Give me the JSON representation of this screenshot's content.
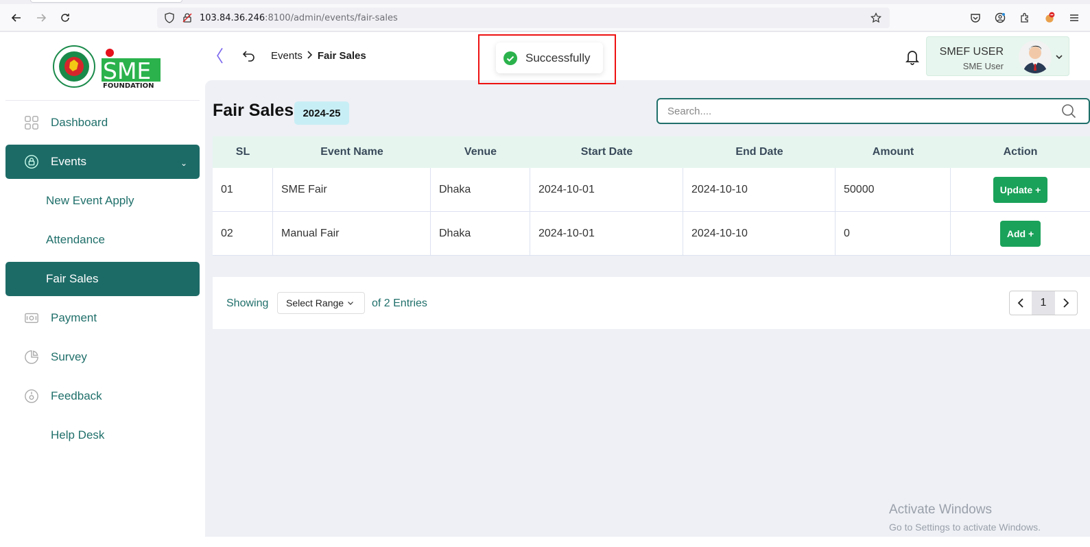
{
  "browser": {
    "url_host": "103.84.36.246",
    "url_rest": ":8100/admin/events/fair-sales"
  },
  "logo": {
    "brand": "SME",
    "sub": "FOUNDATION"
  },
  "sidebar": {
    "items": [
      {
        "label": "Dashboard",
        "icon": "grid-icon",
        "active": false
      },
      {
        "label": "Events",
        "icon": "lock-circle-icon",
        "active": true
      },
      {
        "label": "New Event Apply",
        "sub": true
      },
      {
        "label": "Attendance",
        "sub": true
      },
      {
        "label": "Fair Sales",
        "sub": true,
        "active": true
      },
      {
        "label": "Payment",
        "icon": "cash-icon"
      },
      {
        "label": "Survey",
        "icon": "pie-icon"
      },
      {
        "label": "Feedback",
        "icon": "feedback-icon"
      },
      {
        "label": "Help Desk",
        "icon": ""
      }
    ]
  },
  "header": {
    "breadcrumb_parent": "Events",
    "breadcrumb_current": "Fair Sales",
    "toast_message": "Successfully",
    "user_name": "SMEF USER",
    "user_role": "SME User"
  },
  "page": {
    "title": "Fair Sales",
    "year": "2024-25",
    "search_placeholder": "Search...."
  },
  "table": {
    "columns": [
      "SL",
      "Event Name",
      "Venue",
      "Start Date",
      "End Date",
      "Amount",
      "Action"
    ],
    "rows": [
      {
        "sl": "01",
        "name": "SME Fair",
        "venue": "Dhaka",
        "start": "2024-10-01",
        "end": "2024-10-10",
        "amount": "50000",
        "action": "Update +"
      },
      {
        "sl": "02",
        "name": "Manual Fair",
        "venue": "Dhaka",
        "start": "2024-10-01",
        "end": "2024-10-10",
        "amount": "0",
        "action": "Add +"
      }
    ]
  },
  "footer": {
    "showing": "Showing",
    "range": "Select Range",
    "entries": "of 2 Entries",
    "page": "1"
  },
  "watermark": {
    "line1": "Activate Windows",
    "line2": "Go to Settings to activate Windows."
  },
  "colors": {
    "primary": "#1d6b67",
    "success": "#1aa25a",
    "table_header": "#e6f6ef",
    "toast_frame": "#ee1111"
  }
}
